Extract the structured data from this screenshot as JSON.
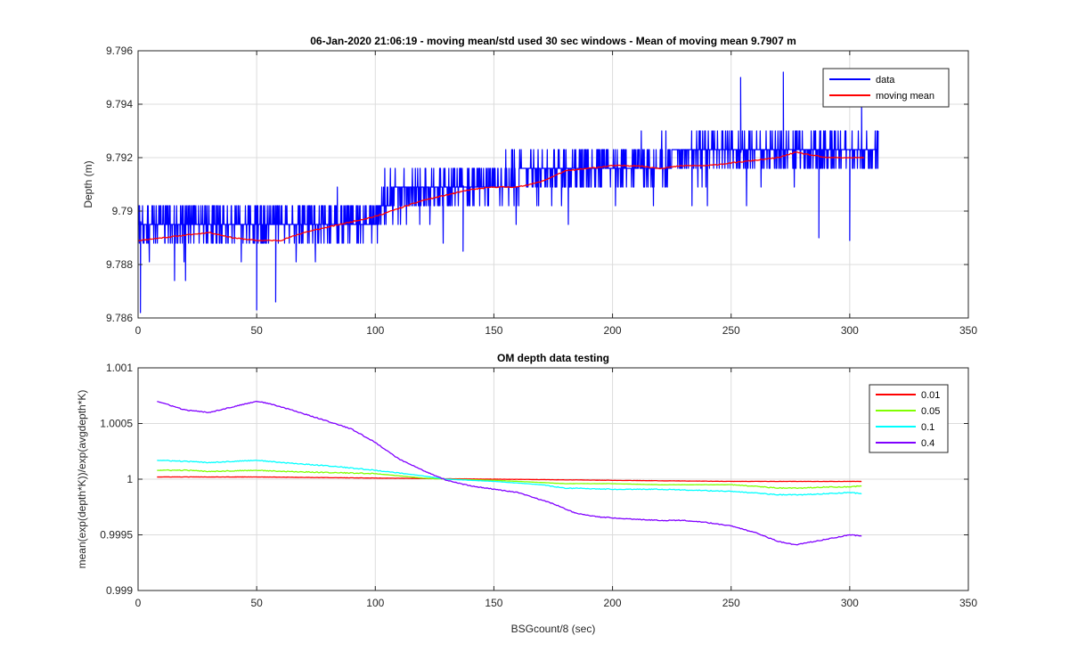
{
  "figure": {
    "background": "#ffffff",
    "axes_background": "#ffffff",
    "grid_color": "#dcdcdc",
    "axis_color": "#262626"
  },
  "chart_data": [
    {
      "type": "line",
      "title": "06-Jan-2020 21:06:19 - moving mean/std used 30 sec windows - Mean of moving mean 9.7907 m",
      "xlabel": "",
      "ylabel": "Depth (m)",
      "xlim": [
        0,
        350
      ],
      "ylim": [
        9.786,
        9.796
      ],
      "xticks": [
        0,
        50,
        100,
        150,
        200,
        250,
        300,
        350
      ],
      "yticks": [
        9.786,
        9.788,
        9.79,
        9.792,
        9.794,
        9.796
      ],
      "xtick_labels": [
        "0",
        "50",
        "100",
        "150",
        "200",
        "250",
        "300",
        "350"
      ],
      "ytick_labels": [
        "9.786",
        "9.788",
        "9.79",
        "9.792",
        "9.794",
        "9.796"
      ],
      "grid": true,
      "legend_position": "top-right",
      "series": [
        {
          "name": "data",
          "color": "#0000ff",
          "style": "noisy",
          "x_range": [
            0,
            312
          ],
          "x_step": 0.125,
          "quantization_m": 0.0007,
          "random_seed": 7,
          "baseline_x": [
            0,
            100,
            103,
            180,
            250,
            312
          ],
          "baseline_y": [
            9.7896,
            9.7897,
            9.7905,
            9.7915,
            9.7922,
            9.7922
          ],
          "noise_m": 0.0008,
          "spike_x": [
            254,
            272,
            305
          ],
          "spike_y": [
            9.795,
            9.7952,
            9.7942
          ],
          "dip_x": [
            1,
            50,
            58,
            137,
            287,
            300
          ],
          "dip_y": [
            9.7862,
            9.7863,
            9.7866,
            9.7885,
            9.789,
            9.7889
          ]
        },
        {
          "name": "moving mean",
          "color": "#ff0000",
          "style": "smooth",
          "x": [
            0,
            10,
            20,
            30,
            40,
            50,
            60,
            70,
            80,
            90,
            100,
            110,
            120,
            130,
            140,
            150,
            160,
            170,
            180,
            190,
            200,
            210,
            220,
            230,
            240,
            250,
            260,
            270,
            277,
            290,
            300,
            306
          ],
          "y": [
            9.7889,
            9.789,
            9.7891,
            9.7892,
            9.789,
            9.7889,
            9.7889,
            9.7892,
            9.7894,
            9.7896,
            9.7898,
            9.7901,
            9.7904,
            9.7906,
            9.7908,
            9.7909,
            9.7909,
            9.7911,
            9.7915,
            9.7916,
            9.7917,
            9.7917,
            9.7916,
            9.7917,
            9.7917,
            9.7918,
            9.7919,
            9.792,
            9.7922,
            9.792,
            9.792,
            9.792
          ]
        }
      ]
    },
    {
      "type": "line",
      "title": "OM depth data testing",
      "xlabel": "BSGcount/8 (sec)",
      "ylabel": "mean(exp(depth*K))/exp(avgdepth*K)",
      "xlim": [
        0,
        350
      ],
      "ylim": [
        0.999,
        1.001
      ],
      "xticks": [
        0,
        50,
        100,
        150,
        200,
        250,
        300,
        350
      ],
      "yticks": [
        0.999,
        0.9995,
        1,
        1.0005,
        1.001
      ],
      "xtick_labels": [
        "0",
        "50",
        "100",
        "150",
        "200",
        "250",
        "300",
        "350"
      ],
      "ytick_labels": [
        "0.999",
        "0.9995",
        "1",
        "1.0005",
        "1.001"
      ],
      "grid": true,
      "legend_position": "top-right",
      "series": [
        {
          "name": "0.01",
          "color": "#ff0000",
          "x": [
            8,
            50,
            100,
            150,
            200,
            250,
            305
          ],
          "y": [
            1.00002,
            1.00002,
            1.00001,
            1.0,
            0.99999,
            0.99998,
            0.99998
          ]
        },
        {
          "name": "0.05",
          "color": "#80ff00",
          "x": [
            8,
            20,
            30,
            50,
            60,
            80,
            100,
            120,
            130,
            150,
            170,
            180,
            200,
            220,
            250,
            270,
            280,
            290,
            300,
            305
          ],
          "y": [
            1.00008,
            1.00008,
            1.00007,
            1.00008,
            1.00007,
            1.00006,
            1.00005,
            1.00001,
            1.0,
            0.99999,
            0.99997,
            0.99996,
            0.99996,
            0.99995,
            0.99995,
            0.99992,
            0.99992,
            0.99993,
            0.99993,
            0.99994
          ]
        },
        {
          "name": "0.1",
          "color": "#00ffff",
          "x": [
            8,
            20,
            30,
            50,
            60,
            80,
            100,
            120,
            130,
            150,
            170,
            180,
            200,
            220,
            250,
            270,
            280,
            290,
            300,
            305
          ],
          "y": [
            1.00017,
            1.00016,
            1.00015,
            1.00017,
            1.00015,
            1.00012,
            1.00008,
            1.00003,
            1.0,
            0.99998,
            0.99995,
            0.99992,
            0.99991,
            0.99991,
            0.99989,
            0.99986,
            0.99986,
            0.99987,
            0.99988,
            0.99987
          ]
        },
        {
          "name": "0.4",
          "color": "#8000ff",
          "x": [
            8,
            20,
            30,
            40,
            50,
            55,
            65,
            80,
            90,
            100,
            110,
            120,
            130,
            140,
            150,
            160,
            175,
            185,
            195,
            210,
            220,
            230,
            240,
            250,
            260,
            270,
            277,
            290,
            300,
            305
          ],
          "y": [
            1.0007,
            1.00062,
            1.0006,
            1.00065,
            1.0007,
            1.00068,
            1.00062,
            1.00052,
            1.00045,
            1.00033,
            1.00018,
            1.00008,
            0.99999,
            0.99994,
            0.99991,
            0.99988,
            0.99978,
            0.99969,
            0.99966,
            0.99964,
            0.99963,
            0.99963,
            0.99961,
            0.99958,
            0.99952,
            0.99944,
            0.99941,
            0.99946,
            0.9995,
            0.99949
          ]
        }
      ]
    }
  ]
}
